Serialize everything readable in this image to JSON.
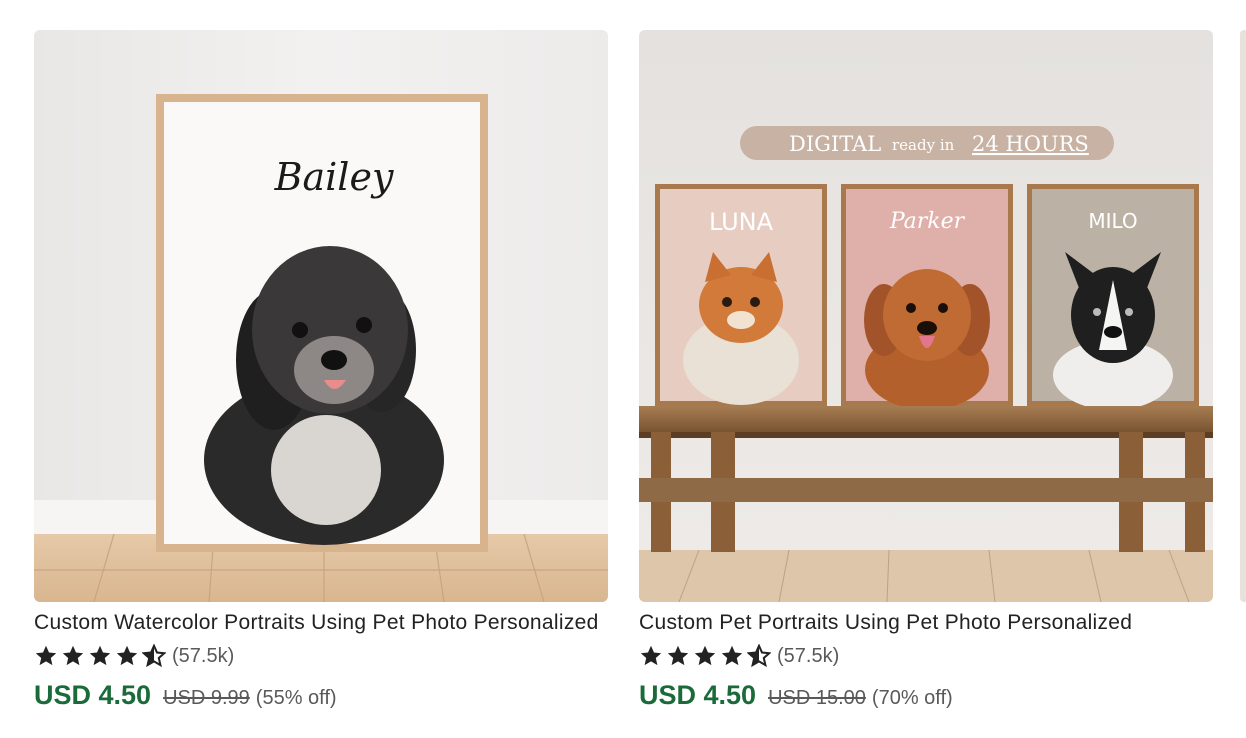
{
  "listings": [
    {
      "image_alt": "Framed watercolor portrait of a black and white puppy",
      "frame_name": "Bailey",
      "title": "Custom Watercolor Portraits Using Pet Photo Personalized",
      "rating": 4.5,
      "review_count": "(57.5k)",
      "price": "USD 4.50",
      "original_price": "USD 9.99",
      "discount": "(55% off)"
    },
    {
      "image_alt": "Three framed pet portraits on a wooden bench",
      "banner": {
        "word1": "DIGITAL",
        "word2": "ready in",
        "word3": "24 HOURS"
      },
      "frame_names": [
        "LUNA",
        "Parker",
        "MILO"
      ],
      "title": "Custom Pet Portraits Using Pet Photo Personalized",
      "rating": 4.5,
      "review_count": "(57.5k)",
      "price": "USD 4.50",
      "original_price": "USD 15.00",
      "discount": "(70% off)"
    }
  ],
  "colors": {
    "price": "#1b6b3a",
    "muted": "#595959",
    "star": "#222222"
  }
}
